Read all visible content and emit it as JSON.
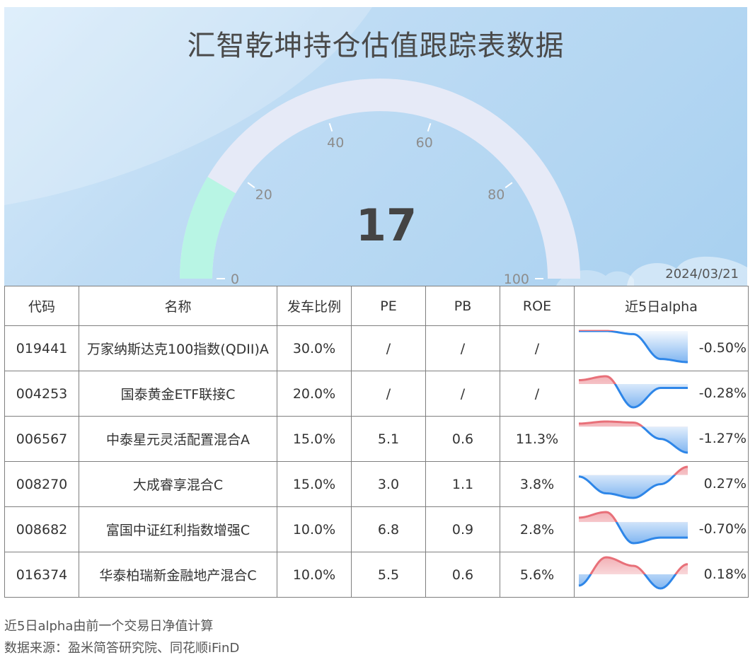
{
  "title": "汇智乾坤持仓估值跟踪表数据",
  "date": "2024/03/21",
  "gauge": {
    "value": 17,
    "value_label": "17",
    "min": 0,
    "max": 100,
    "ticks": [
      "0",
      "20",
      "40",
      "60",
      "80",
      "100"
    ],
    "fill_color": "#b8f5e4",
    "track_color": "#e6eaf7"
  },
  "table": {
    "headers": [
      "代码",
      "名称",
      "发车比例",
      "PE",
      "PB",
      "ROE",
      "近5日alpha"
    ],
    "rows": [
      {
        "code": "019441",
        "name": "万家纳斯达克100指数(QDII)A",
        "ratio": "30.0%",
        "pe": "/",
        "pb": "/",
        "roe": "/",
        "alpha": "-0.50%",
        "trend": [
          0.0,
          0.0,
          -0.05,
          -0.45,
          -0.5
        ]
      },
      {
        "code": "004253",
        "name": "国泰黄金ETF联接C",
        "ratio": "20.0%",
        "pe": "/",
        "pb": "/",
        "roe": "/",
        "alpha": "-0.28%",
        "trend": [
          0.05,
          0.1,
          -0.3,
          -0.05,
          -0.05
        ]
      },
      {
        "code": "006567",
        "name": "中泰星元灵活配置混合A",
        "ratio": "15.0%",
        "pe": "5.1",
        "pb": "0.6",
        "roe": "11.3%",
        "alpha": "-1.27%",
        "trend": [
          0.15,
          0.25,
          0.2,
          -0.6,
          -1.27
        ]
      },
      {
        "code": "008270",
        "name": "大成睿享混合C",
        "ratio": "15.0%",
        "pe": "3.0",
        "pb": "1.1",
        "roe": "3.8%",
        "alpha": "0.27%",
        "trend": [
          -0.05,
          -0.6,
          -0.75,
          -0.3,
          0.27
        ]
      },
      {
        "code": "008682",
        "name": "富国中证红利指数增强C",
        "ratio": "10.0%",
        "pe": "6.8",
        "pb": "0.9",
        "roe": "2.8%",
        "alpha": "-0.70%",
        "trend": [
          0.2,
          0.45,
          -0.95,
          -0.7,
          -0.7
        ]
      },
      {
        "code": "016374",
        "name": "华泰柏瑞新金融地产混合C",
        "ratio": "10.0%",
        "pe": "5.5",
        "pb": "0.6",
        "roe": "5.6%",
        "alpha": "0.18%",
        "trend": [
          -0.2,
          0.3,
          0.15,
          -0.25,
          0.18
        ]
      }
    ]
  },
  "notes": [
    "近5日alpha由前一个交易日净值计算",
    "数据来源：盈米简答研究院、同花顺iFinD"
  ],
  "colors": {
    "positive": "#e87079",
    "negative": "#2e86e8"
  }
}
